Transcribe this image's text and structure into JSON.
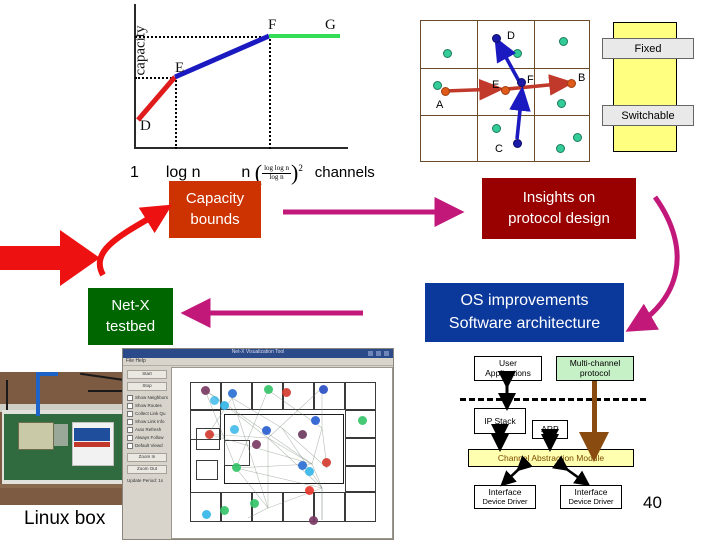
{
  "slide": {
    "page_number": "40"
  },
  "chart_data": {
    "type": "line",
    "title": "",
    "xlabel": "channels",
    "ylabel": "capacity",
    "grid": false,
    "legend": "none",
    "x_tick_labels": [
      "1",
      "log n",
      "n (log log n / log n)^2"
    ],
    "point_labels": [
      "D",
      "E",
      "F",
      "G"
    ],
    "series": [
      {
        "name": "red-segment",
        "color": "#e01b1b",
        "points": [
          [
            0.04,
            0.1
          ],
          [
            0.28,
            0.46
          ]
        ]
      },
      {
        "name": "blue-segment",
        "color": "#1a1ac0",
        "points": [
          [
            0.28,
            0.46
          ],
          [
            0.72,
            0.79
          ]
        ]
      },
      {
        "name": "green-segment",
        "color": "#33dd55",
        "points": [
          [
            0.72,
            0.79
          ],
          [
            1.0,
            0.79
          ]
        ]
      }
    ],
    "annotations": [
      {
        "label": "D",
        "x": 0.05,
        "y": 0.06
      },
      {
        "label": "E",
        "x": 0.28,
        "y": 0.53
      },
      {
        "label": "F",
        "x": 0.72,
        "y": 0.88
      },
      {
        "label": "G",
        "x": 0.97,
        "y": 0.88
      }
    ],
    "xaxis_expression": {
      "lead": "1",
      "mid": "log n",
      "coeff": "n",
      "frac_num": "log log n",
      "frac_den": "log n",
      "exponent": "2",
      "unit": "channels"
    }
  },
  "network_diagram": {
    "node_labels": [
      "A",
      "B",
      "C",
      "D",
      "E",
      "F"
    ],
    "flows": [
      {
        "name": "orange-flow",
        "from": "A",
        "to": "B",
        "color": "#c0392b"
      },
      {
        "name": "blue-flow",
        "from": "C",
        "to": "D",
        "color": "#1a1ac0"
      }
    ]
  },
  "interface_legend": {
    "fixed_label": "Fixed",
    "switchable_label": "Switchable"
  },
  "callouts": {
    "capacity": {
      "line1": "Capacity",
      "line2": "bounds",
      "color": "#cc3300"
    },
    "insights": {
      "line1": "Insights on",
      "line2": "protocol design",
      "color": "#990000"
    },
    "netx": {
      "line1": "Net-X",
      "line2": "testbed",
      "color": "#006600"
    },
    "os": {
      "line1": "OS improvements",
      "line2": "Software architecture",
      "color": "#0b399b"
    }
  },
  "photo": {
    "caption": "Linux box"
  },
  "visualizer": {
    "window_title": "Net-X Visualization Tool",
    "menu": "File   Help",
    "buttons": [
      "Start",
      "Stop"
    ],
    "checkboxes": [
      "Show Neighbors",
      "Show Routes",
      "Collect Link Qu",
      "Show Link Info",
      "Auto Refresh",
      "Always Follow",
      "Default Viewd"
    ],
    "action_buttons": [
      "Zoom In",
      "Zoom Out"
    ],
    "status": "Update Period: 1s"
  },
  "architecture": {
    "boxes": [
      {
        "name": "user-applications",
        "line1": "User",
        "line2": "Applications",
        "fill": "#ffffff"
      },
      {
        "name": "multi-channel-protocol",
        "line1": "Multi-channel",
        "line2": "protocol",
        "fill": "#c6f0c6"
      },
      {
        "name": "ip-stack",
        "line1": "IP Stack",
        "line2": "",
        "fill": "#ffffff"
      },
      {
        "name": "arp",
        "line1": "ARP",
        "line2": "",
        "fill": "#ffffff"
      },
      {
        "name": "channel-abstraction-module",
        "line1": "Channel Abstraction Module",
        "line2": "",
        "fill": "#ffffb0"
      },
      {
        "name": "interface-driver-left",
        "line1": "Interface",
        "line2": "Device Driver",
        "fill": "#ffffff"
      },
      {
        "name": "interface-driver-right",
        "line1": "Interface",
        "line2": "Device Driver",
        "fill": "#ffffff"
      }
    ]
  }
}
